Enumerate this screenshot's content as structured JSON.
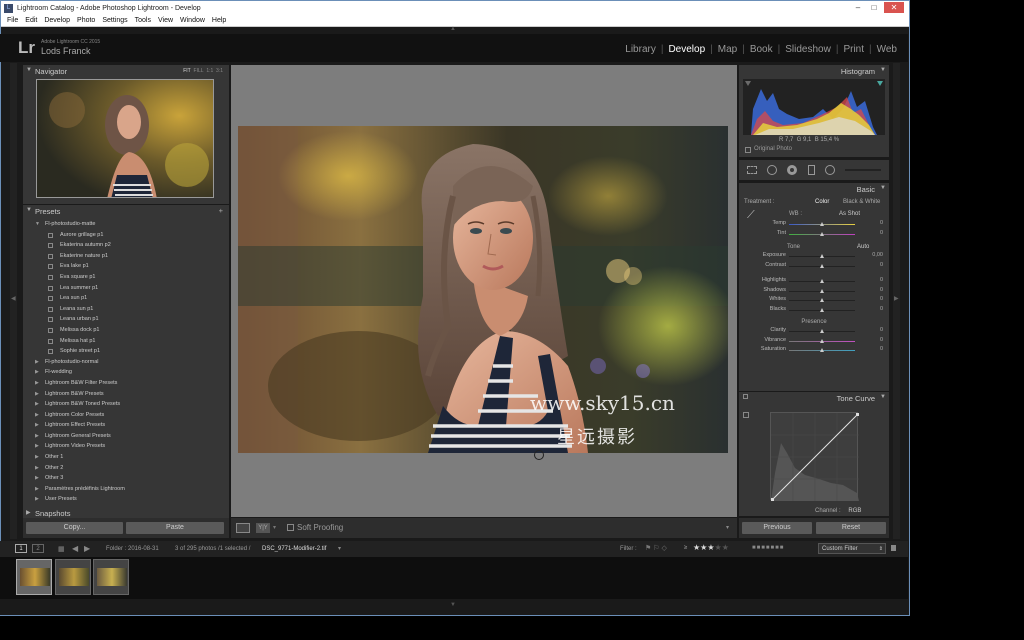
{
  "window": {
    "title": "Lightroom Catalog - Adobe Photoshop Lightroom - Develop",
    "minimize": "–",
    "maximize": "□",
    "close": "✕"
  },
  "menu": [
    "File",
    "Edit",
    "Develop",
    "Photo",
    "Settings",
    "Tools",
    "View",
    "Window",
    "Help"
  ],
  "identity": {
    "logo": "Lr",
    "product": "Adobe Lightroom CC 2015",
    "user": "Lods Franck"
  },
  "modules": [
    "Library",
    "Develop",
    "Map",
    "Book",
    "Slideshow",
    "Print",
    "Web"
  ],
  "active_module": "Develop",
  "navigator": {
    "title": "Navigator",
    "options": [
      "FIT",
      "FILL",
      "1:1",
      "3:1"
    ]
  },
  "presets": {
    "title": "Presets",
    "add": "+",
    "items": [
      {
        "label": "Fl-photostudio-matte",
        "type": "folder-open"
      },
      {
        "label": "Aurore grillage p1",
        "type": "preset"
      },
      {
        "label": "Ekaterina autumn p2",
        "type": "preset"
      },
      {
        "label": "Ekaterine nature p1",
        "type": "preset"
      },
      {
        "label": "Eva lake p1",
        "type": "preset"
      },
      {
        "label": "Eva square p1",
        "type": "preset"
      },
      {
        "label": "Lea summer p1",
        "type": "preset"
      },
      {
        "label": "Lea sun p1",
        "type": "preset"
      },
      {
        "label": "Leana sun p1",
        "type": "preset"
      },
      {
        "label": "Leana urban p1",
        "type": "preset"
      },
      {
        "label": "Melissa dock p1",
        "type": "preset"
      },
      {
        "label": "Melissa hat p1",
        "type": "preset"
      },
      {
        "label": "Sophie street p1",
        "type": "preset"
      },
      {
        "label": "Fl-photostudio-normal",
        "type": "folder"
      },
      {
        "label": "Fl-wedding",
        "type": "folder"
      },
      {
        "label": "Lightroom B&W Filter Presets",
        "type": "folder"
      },
      {
        "label": "Lightroom B&W Presets",
        "type": "folder"
      },
      {
        "label": "Lightroom B&W Toned Presets",
        "type": "folder"
      },
      {
        "label": "Lightroom Color Presets",
        "type": "folder"
      },
      {
        "label": "Lightroom Effect Presets",
        "type": "folder"
      },
      {
        "label": "Lightroom General Presets",
        "type": "folder"
      },
      {
        "label": "Lightroom Video Presets",
        "type": "folder"
      },
      {
        "label": "Other 1",
        "type": "folder"
      },
      {
        "label": "Other 2",
        "type": "folder"
      },
      {
        "label": "Other 3",
        "type": "folder"
      },
      {
        "label": "Paramètres prédéfinis Lightroom",
        "type": "folder"
      },
      {
        "label": "User Presets",
        "type": "folder"
      }
    ]
  },
  "snapshots": {
    "title": "Snapshots"
  },
  "left_buttons": {
    "copy": "Copy...",
    "paste": "Paste"
  },
  "toolbar": {
    "soft_proofing": "Soft Proofing"
  },
  "watermark": {
    "url": "www.sky15.cn",
    "cn": "星远摄影"
  },
  "histogram": {
    "title": "Histogram",
    "r_label": "R",
    "r": "7,7",
    "g_label": "G",
    "g": "9,1",
    "b_label": "B",
    "b": "15,4",
    "pct": "%",
    "original": "Original Photo"
  },
  "basic": {
    "title": "Basic",
    "treatment": "Treatment :",
    "color": "Color",
    "bw": "Black & White",
    "wb_label": "WB :",
    "wb_value": "As Shot",
    "tone_label": "Tone",
    "auto": "Auto",
    "presence_label": "Presence",
    "wb_sliders": [
      {
        "label": "Temp",
        "value": "0",
        "pos": 0.5
      },
      {
        "label": "Tint",
        "value": "0",
        "pos": 0.5
      }
    ],
    "tone_sliders": [
      {
        "label": "Exposure",
        "value": "0,00",
        "pos": 0.5
      },
      {
        "label": "Contrast",
        "value": "0",
        "pos": 0.5
      }
    ],
    "tone2_sliders": [
      {
        "label": "Highlights",
        "value": "0",
        "pos": 0.5
      },
      {
        "label": "Shadows",
        "value": "0",
        "pos": 0.5
      },
      {
        "label": "Whites",
        "value": "0",
        "pos": 0.5
      },
      {
        "label": "Blacks",
        "value": "0",
        "pos": 0.5
      }
    ],
    "presence_sliders": [
      {
        "label": "Clarity",
        "value": "0",
        "pos": 0.5
      },
      {
        "label": "Vibrance",
        "value": "0",
        "pos": 0.5
      },
      {
        "label": "Saturation",
        "value": "0",
        "pos": 0.5
      }
    ]
  },
  "tone_curve": {
    "title": "Tone Curve",
    "channel": "Channel :",
    "channel_value": "RGB"
  },
  "right_buttons": {
    "previous": "Previous",
    "reset": "Reset"
  },
  "filmbar": {
    "page1": "1",
    "page2": "2",
    "folder": "Folder : 2016-08-31",
    "count": "3 of 295 photos /1 selected /",
    "file": "DSC_9771-Modifier-2.tif",
    "filter_label": "Filter :",
    "filter_value": "Custom Filter",
    "rating_op": "≥",
    "rating": 3
  },
  "colors": {
    "accent": "#ffffff",
    "panel": "#363636",
    "background": "#1a1a1a"
  }
}
